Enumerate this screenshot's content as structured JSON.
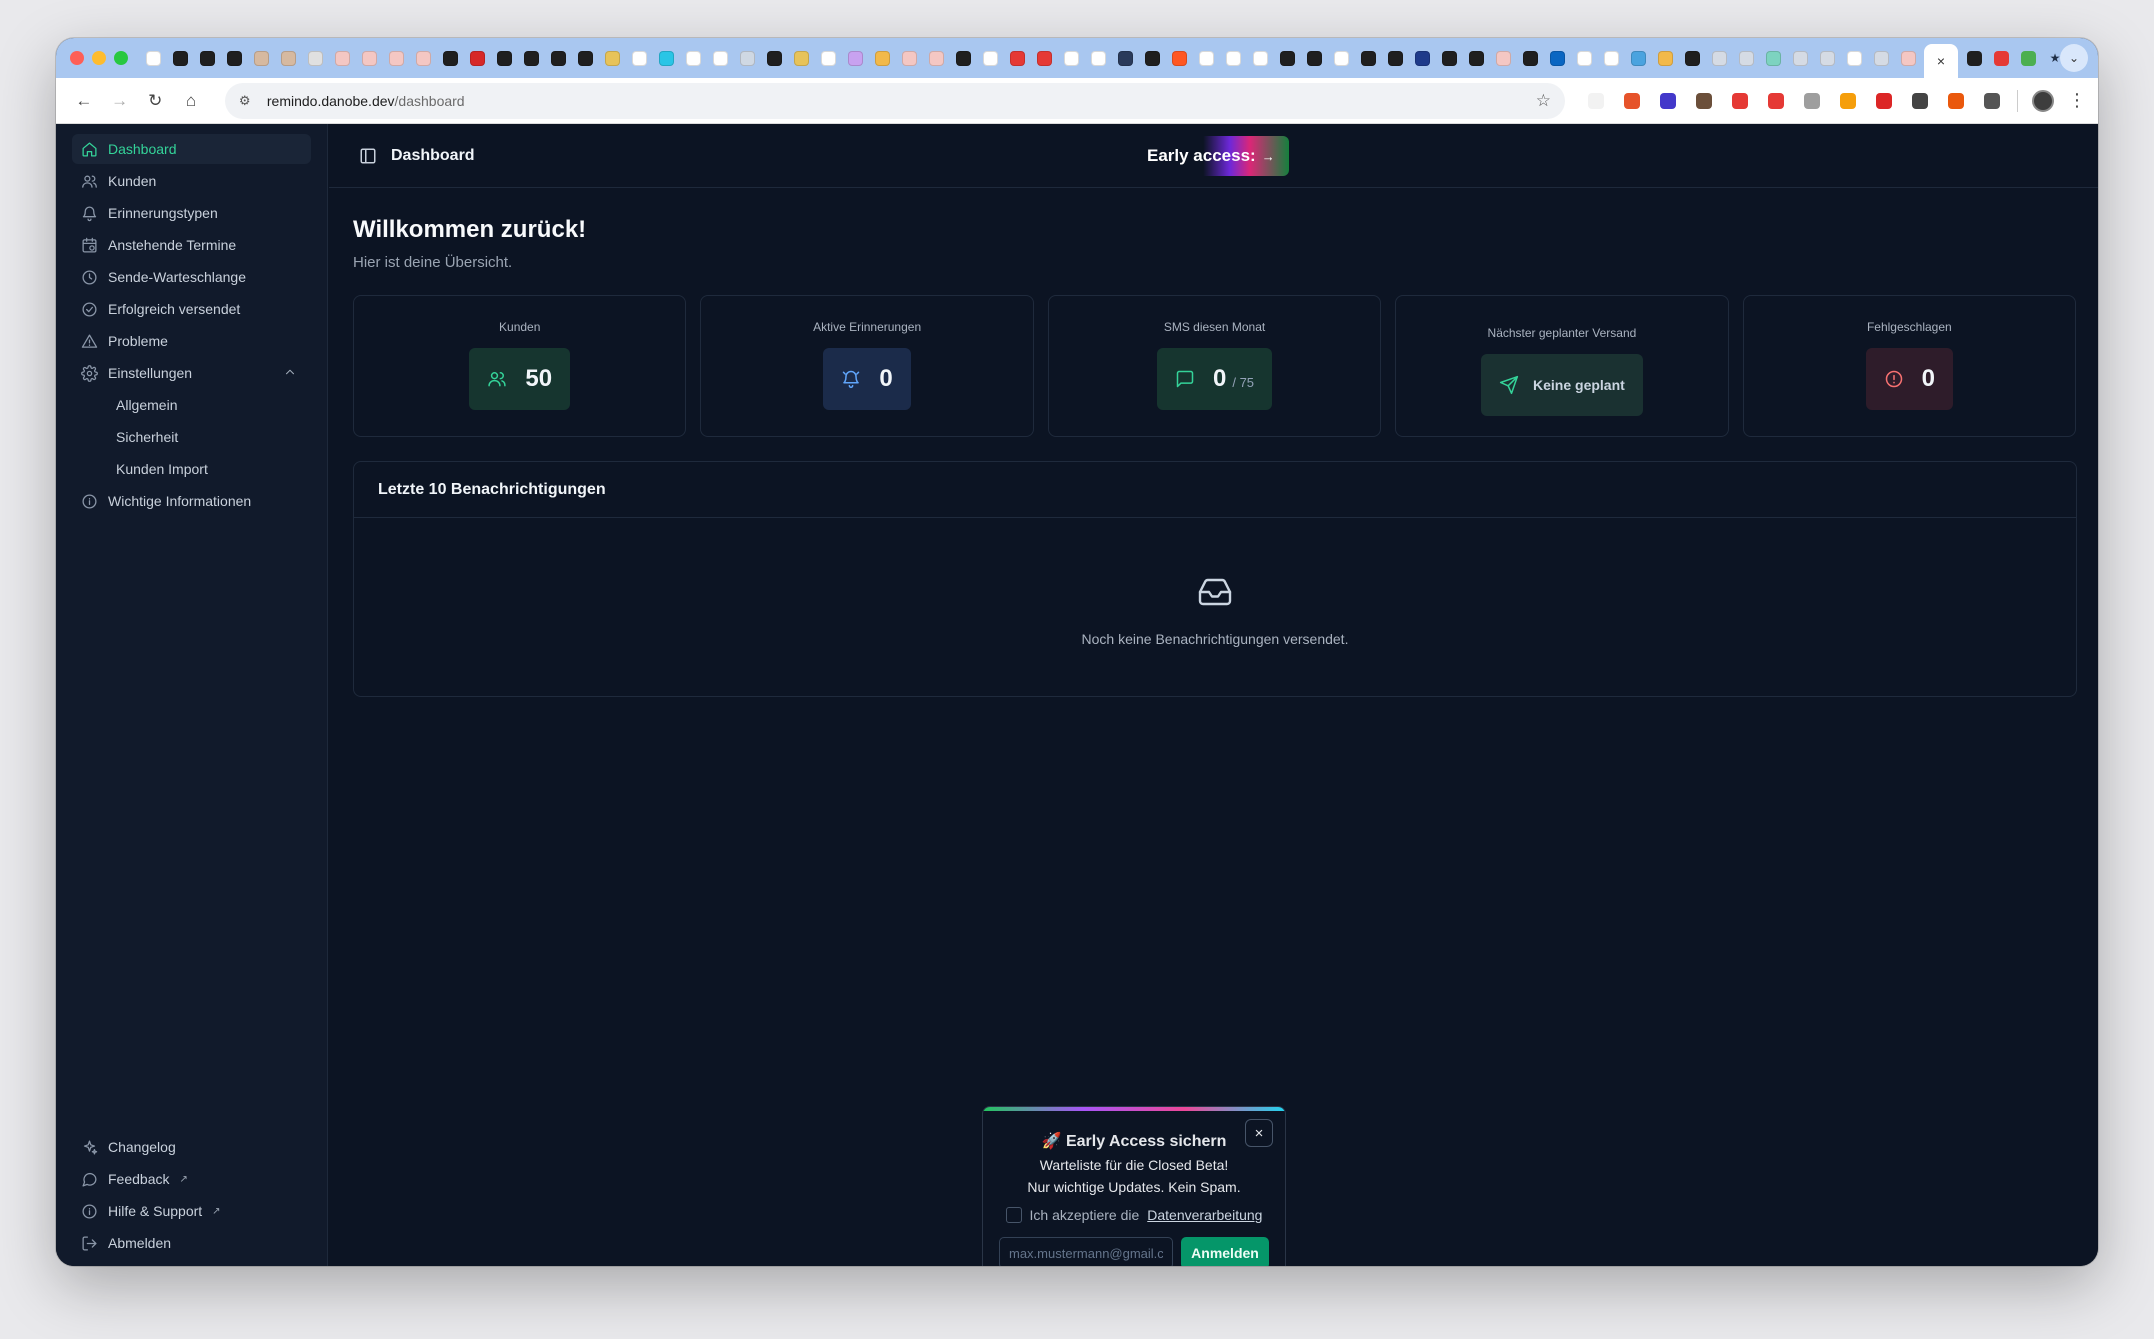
{
  "browser": {
    "url_host": "remindo.danobe.dev",
    "url_path": "/dashboard",
    "active_tab_close": "×",
    "new_tab": "+"
  },
  "sidebar": {
    "items": [
      {
        "label": "Dashboard",
        "icon": "home-icon",
        "active": true
      },
      {
        "label": "Kunden",
        "icon": "users-icon"
      },
      {
        "label": "Erinnerungstypen",
        "icon": "bell-icon"
      },
      {
        "label": "Anstehende Termine",
        "icon": "calendar-clock-icon"
      },
      {
        "label": "Sende-Warteschlange",
        "icon": "clock-icon"
      },
      {
        "label": "Erfolgreich versendet",
        "icon": "check-circle-icon"
      },
      {
        "label": "Probleme",
        "icon": "warning-triangle-icon"
      },
      {
        "label": "Einstellungen",
        "icon": "gear-icon",
        "expanded": true
      }
    ],
    "settings_sub": [
      {
        "label": "Allgemein"
      },
      {
        "label": "Sicherheit"
      },
      {
        "label": "Kunden Import"
      }
    ],
    "info_item": {
      "label": "Wichtige Informationen",
      "icon": "info-icon"
    },
    "bottom": [
      {
        "label": "Changelog",
        "icon": "sparkles-icon"
      },
      {
        "label": "Feedback",
        "icon": "message-circle-icon",
        "external": "↗"
      },
      {
        "label": "Hilfe & Support",
        "icon": "help-circle-icon",
        "external": "↗"
      },
      {
        "label": "Abmelden",
        "icon": "logout-icon"
      }
    ]
  },
  "header": {
    "title": "Dashboard",
    "early_access": "Early access:",
    "early_access_arrow": "→"
  },
  "main": {
    "welcome_title": "Willkommen zurück!",
    "welcome_sub": "Hier ist deine Übersicht.",
    "stats": [
      {
        "label": "Kunden",
        "value": "50",
        "icon": "users-icon",
        "color": "#16352f"
      },
      {
        "label": "Aktive Erinnerungen",
        "value": "0",
        "icon": "bell-ring-icon",
        "color": "#1b2b4a"
      },
      {
        "label": "SMS diesen Monat",
        "value": "0",
        "suffix": "/ 75",
        "icon": "message-square-icon",
        "color": "#16352f"
      },
      {
        "label": "Nächster geplanter Versand",
        "value": "Keine geplant",
        "icon": "send-icon",
        "color": "#1a3131"
      },
      {
        "label": "Fehlgeschlagen",
        "value": "0",
        "icon": "alert-circle-icon",
        "color": "#2e1c2a"
      }
    ],
    "recent_title": "Letzte 10 Benachrichtigungen",
    "recent_empty": "Noch keine Benachrichtigungen versendet."
  },
  "popup": {
    "title": "🚀 Early Access sichern",
    "line1": "Warteliste für die Closed Beta!",
    "line2": "Nur wichtige Updates. Kein Spam.",
    "consent_prefix": "Ich akzeptiere die",
    "consent_link": "Datenverarbeitung",
    "email_placeholder": "max.mustermann@gmail.com",
    "submit": "Anmelden",
    "close": "×"
  },
  "colors": {
    "accent": "#34d399",
    "background": "#0c1423",
    "sidebar": "#111a2b",
    "submit": "#059669"
  }
}
